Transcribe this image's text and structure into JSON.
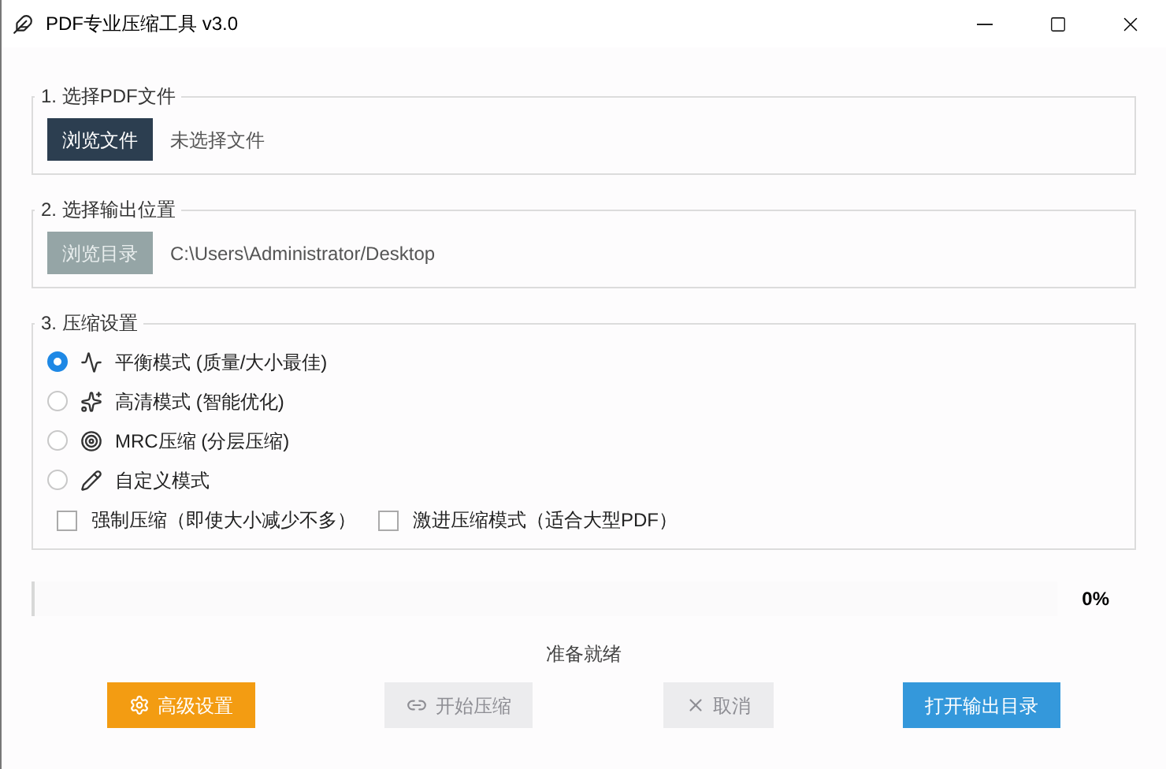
{
  "window": {
    "title": "PDF专业压缩工具 v3.0"
  },
  "file_section": {
    "legend": "1. 选择PDF文件",
    "button": {
      "label": "浏览文件",
      "disabled": false
    },
    "value": "未选择文件"
  },
  "output_section": {
    "legend": "2. 选择输出位置",
    "button": {
      "label": "浏览目录",
      "disabled": true
    },
    "value": "C:\\Users\\Administrator/Desktop"
  },
  "compress_section": {
    "legend": "3. 压缩设置",
    "modes": [
      {
        "label": "平衡模式 (质量/大小最佳)",
        "kind": "balance",
        "selected": true
      },
      {
        "label": "高清模式 (智能优化)",
        "kind": "sparkle",
        "selected": false
      },
      {
        "label": "MRC压缩 (分层压缩)",
        "kind": "target",
        "selected": false
      },
      {
        "label": "自定义模式",
        "kind": "pencil",
        "selected": false
      }
    ],
    "options": [
      {
        "label": "强制压缩（即使大小减少不多）",
        "checked": false
      },
      {
        "label": "激进压缩模式（适合大型PDF）",
        "checked": false
      }
    ]
  },
  "progress": {
    "level": 0,
    "reading": "0%"
  },
  "status": "准备就绪",
  "buttons": [
    {
      "label": "高级设置",
      "kind": "settings",
      "disabled": false
    },
    {
      "label": "开始压缩",
      "kind": "start",
      "disabled": true
    },
    {
      "label": "取消",
      "kind": "cancel",
      "disabled": true
    },
    {
      "label": "打开输出目录",
      "kind": "open",
      "disabled": false
    }
  ]
}
